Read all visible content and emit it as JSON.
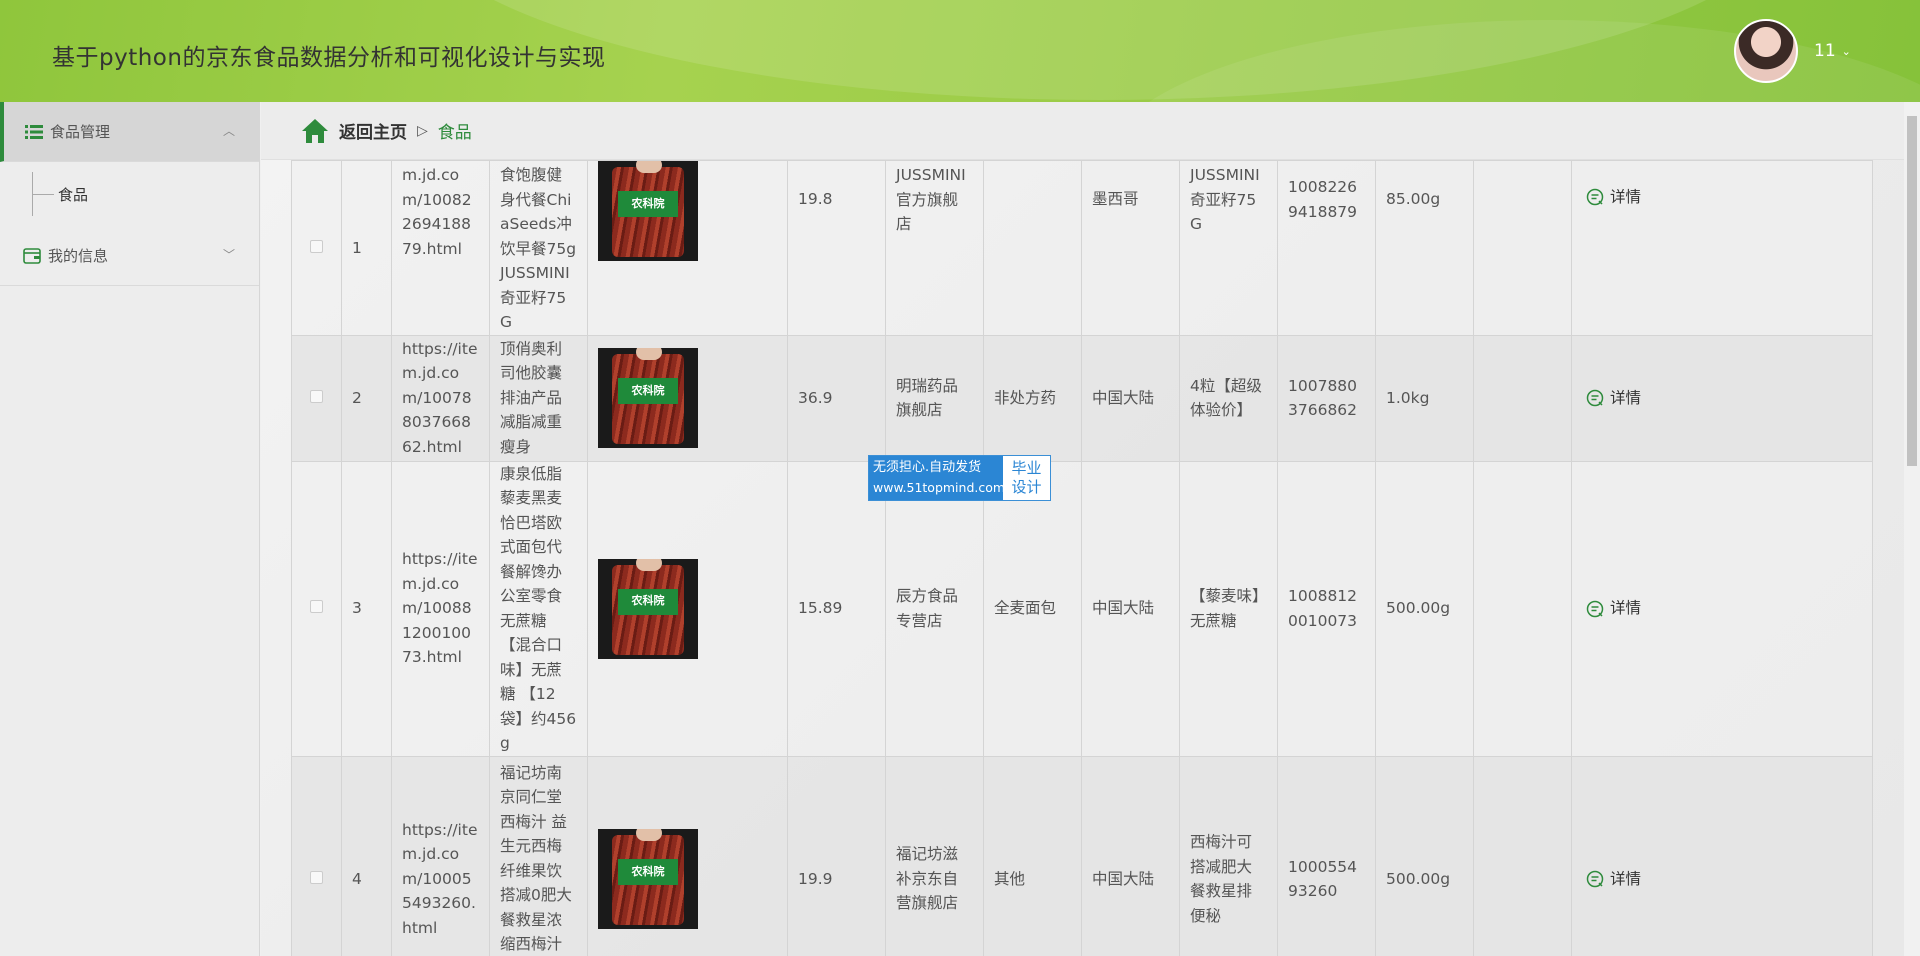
{
  "header": {
    "title": "基于python的京东食品数据分析和可视化设计与实现",
    "user_name": "11"
  },
  "sidebar": {
    "groups": [
      {
        "label": "食品管理",
        "expanded": true,
        "items": [
          {
            "label": "食品"
          }
        ]
      },
      {
        "label": "我的信息",
        "expanded": false,
        "items": []
      }
    ]
  },
  "breadcrumb": {
    "home": "返回主页",
    "current": "食品"
  },
  "table": {
    "detail_label": "详情",
    "image_label": "农科院",
    "rows": [
      {
        "index": "1",
        "url": "m.jd.com/10082269418879.html",
        "name": "食饱腹健身代餐ChiaSeeds冲饮早餐75g JUSSMINI奇亚籽75G",
        "price": "19.8",
        "shop": "JUSSMINI官方旗舰店",
        "category": "",
        "origin": "墨西哥",
        "spec": "JUSSMINI奇亚籽75G",
        "sku": "10082269418879",
        "weight": "85.00g"
      },
      {
        "index": "2",
        "url": "https://item.jd.com/10078803766862.html",
        "name": "顶俏奥利司他胶囊排油产品减脂减重瘦身",
        "price": "36.9",
        "shop": "明瑞药品旗舰店",
        "category": "非处方药",
        "origin": "中国大陆",
        "spec": "4粒【超级体验价】",
        "sku": "10078803766862",
        "weight": "1.0kg"
      },
      {
        "index": "3",
        "url": "https://item.jd.com/10088120010073.html",
        "name": "康泉低脂藜麦黑麦恰巴塔欧式面包代餐解馋办公室零食无蔗糖【混合口味】无蔗糖 【12袋】约456g",
        "price": "15.89",
        "shop": "辰方食品专营店",
        "category": "全麦面包",
        "origin": "中国大陆",
        "spec": "【藜麦味】无蔗糖",
        "sku": "10088120010073",
        "weight": "500.00g"
      },
      {
        "index": "4",
        "url": "https://item.jd.com/100055493260.html",
        "name": "福记坊南京同仁堂西梅汁 益生元西梅纤维果饮搭减0肥大餐救星浓缩西梅汁",
        "price": "19.9",
        "shop": "福记坊滋补京东自营旗舰店",
        "category": "其他",
        "origin": "中国大陆",
        "spec": "西梅汁可搭减肥大餐救星排便秘",
        "sku": "100055493260",
        "weight": "500.00g"
      }
    ]
  },
  "watermark": {
    "line1": "无须担心.自动发货",
    "line2": "www.51topmind.com",
    "right_line1": "毕业",
    "right_line2": "设计"
  }
}
